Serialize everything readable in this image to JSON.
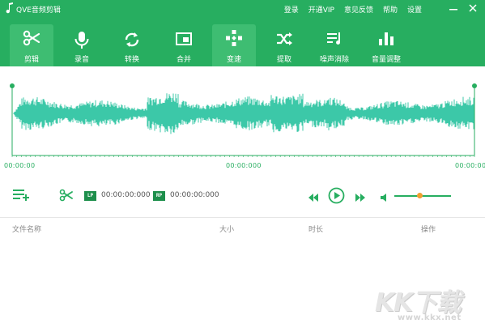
{
  "app": {
    "title": "QVE音频剪辑"
  },
  "top_menu": [
    "登录",
    "开通VIP",
    "意见反馈",
    "帮助",
    "设置"
  ],
  "toolbar": {
    "items": [
      {
        "label": "剪辑",
        "icon": "scissors-icon",
        "active": true
      },
      {
        "label": "录音",
        "icon": "microphone-icon",
        "active": false
      },
      {
        "label": "转换",
        "icon": "convert-icon",
        "active": false
      },
      {
        "label": "合并",
        "icon": "merge-icon",
        "active": false
      },
      {
        "label": "变速",
        "icon": "speed-icon",
        "active": true
      },
      {
        "label": "提取",
        "icon": "shuffle-icon",
        "active": false
      },
      {
        "label": "噪声消除",
        "icon": "noise-reduction-icon",
        "active": false
      },
      {
        "label": "音量调整",
        "icon": "volume-bars-icon",
        "active": false
      }
    ]
  },
  "timeline": {
    "start": "00:00:00",
    "middle": "00:00:000",
    "end": "00:00:00"
  },
  "controls": {
    "lp_label": "LP",
    "lp_time": "00:00:00:000",
    "rp_label": "RP",
    "rp_time": "00:00:00:000",
    "volume_level": 0.45
  },
  "file_list": {
    "columns": [
      "文件名称",
      "大小",
      "时长",
      "操作"
    ],
    "rows": []
  },
  "watermark": {
    "logo": "KK下载",
    "url": "www.kkx.net"
  },
  "colors": {
    "brand": "#27ae60",
    "wave": "#3cc8a8",
    "accent": "#f0a030"
  }
}
